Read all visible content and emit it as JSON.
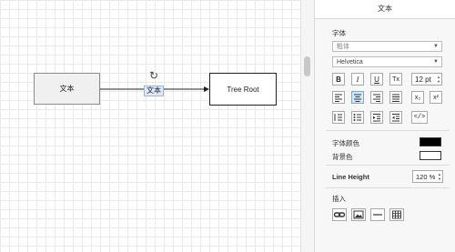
{
  "diagram": {
    "node_left": {
      "label": "文本"
    },
    "node_right": {
      "label": "Tree Root"
    },
    "edge_label": "文本",
    "rotate_glyph": "↻"
  },
  "panel": {
    "title": "文本",
    "font_section_label": "字体",
    "style_select": "粗体",
    "font_select": "Helvetica",
    "font_size": "12 pt",
    "format_buttons": {
      "bold": "B",
      "italic": "I",
      "underline": "U",
      "clear": "Tx"
    },
    "align_buttons": [
      "align-left",
      "align-center",
      "align-right",
      "align-justify"
    ],
    "script_buttons": {
      "subscript": "x₂",
      "superscript": "x²"
    },
    "list_buttons": [
      "ordered-list",
      "unordered-list",
      "indent",
      "outdent"
    ],
    "html_button": "</>",
    "font_color_label": "字体颜色",
    "bg_color_label": "背景色",
    "font_color": "#000000",
    "bg_color": "#ffffff",
    "line_height_label": "Line Height",
    "line_height_value": "120 %",
    "insert_label": "插入",
    "insert_buttons": [
      "link-icon",
      "image-icon",
      "horizontal-rule-icon",
      "table-icon"
    ]
  }
}
